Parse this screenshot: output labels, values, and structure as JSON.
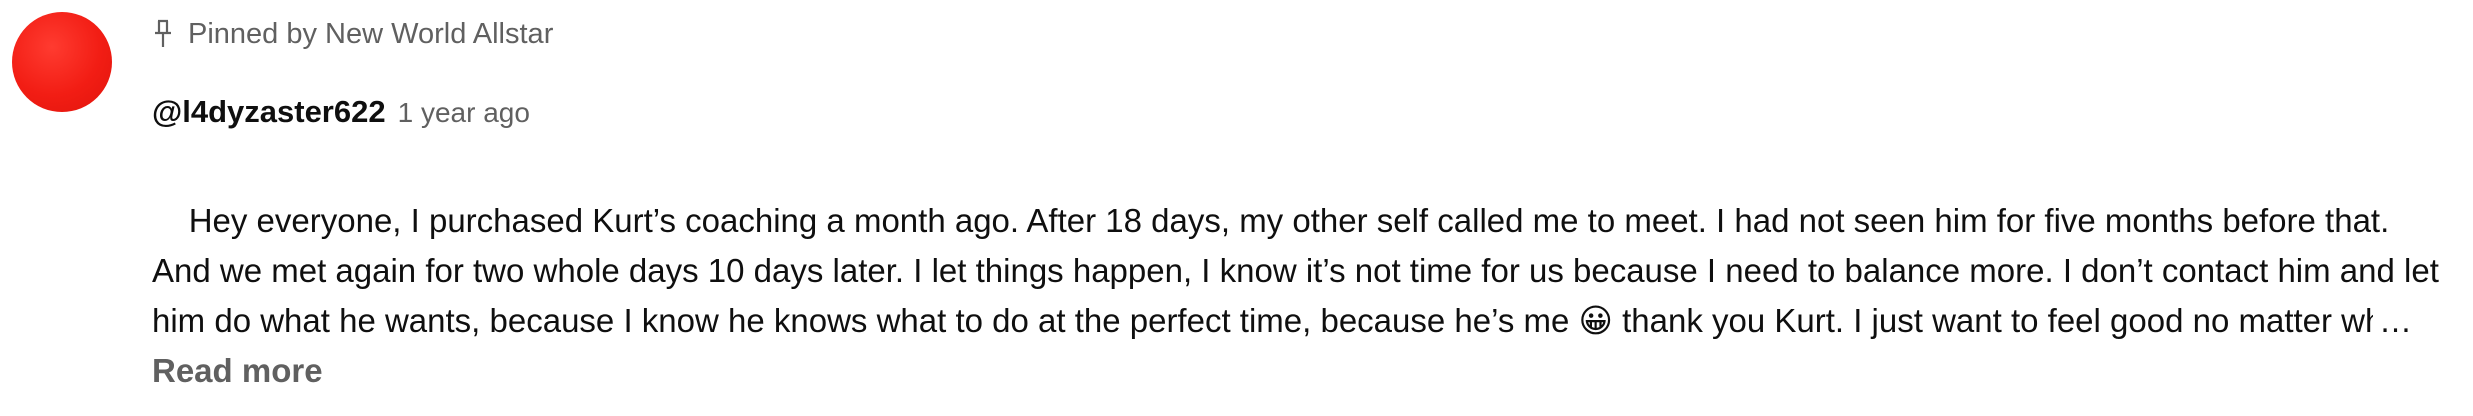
{
  "comment": {
    "pinned_label": "Pinned by New World Allstar",
    "author": "@l4dyzaster622",
    "timestamp": "1 year ago",
    "text": "Hey everyone, I purchased Kurt’s coaching a month ago. After 18 days, my other self called me to meet. I had not seen him for five months before that. And we met again for two whole days 10 days later. I let things happen, I know it’s not time for us because I need to balance more. I don’t contact him and let him do what he wants, because I know he knows what to do at the perfect time, because he’s me 😀 thank you Kurt. I just want to feel good no matter what happens. I’m just starting my journey, but it’s already « working ». Just wanted to say that to encourage people to take",
    "ellipsis": "…",
    "read_more_label": "Read more",
    "avatar_color": "#f21d14"
  },
  "icons": {
    "pin": "pin-icon"
  }
}
